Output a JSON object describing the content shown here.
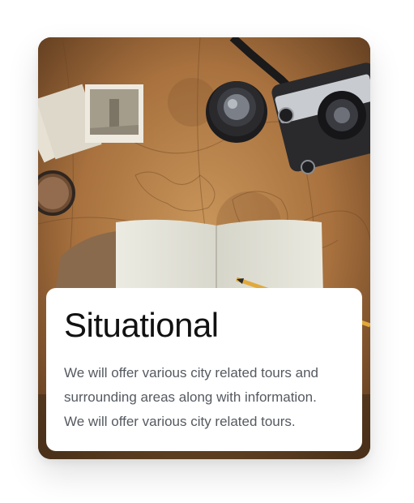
{
  "card": {
    "title": "Situational",
    "description": "We will offer various city related tours and surrounding areas along with information. We will offer various city related tours.",
    "image_subject": "map-notebook-camera-photo"
  },
  "colors": {
    "title": "#111111",
    "description": "#555a60",
    "caption_background": "#ffffff",
    "map_tone": "#b07a45"
  }
}
